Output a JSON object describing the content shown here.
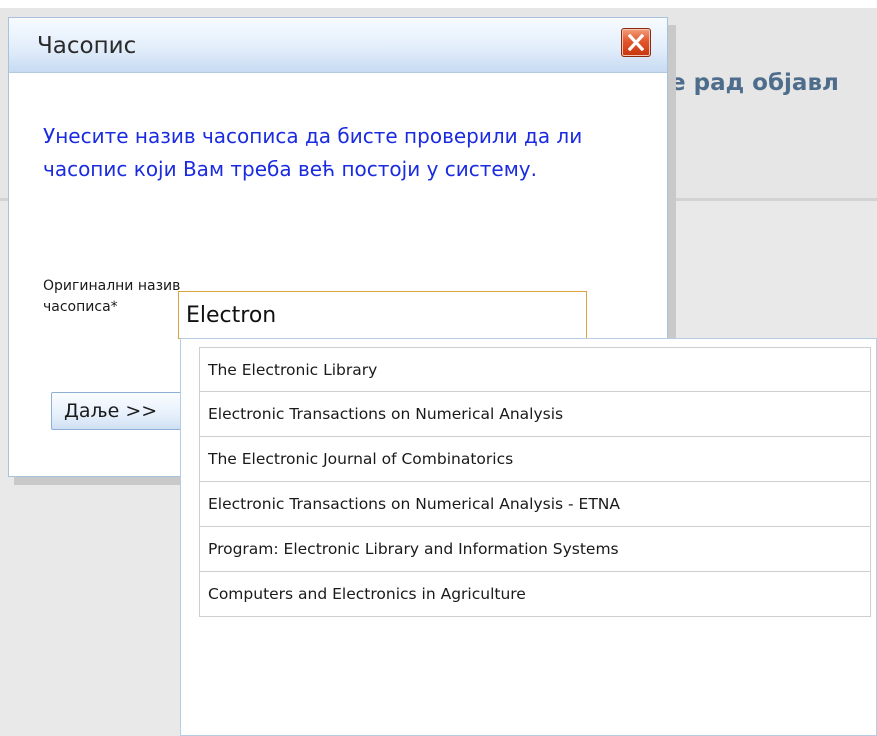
{
  "background": {
    "heading_fragment": "е рад објавл"
  },
  "dialog": {
    "title": "Часопис",
    "close_icon": "close-icon",
    "intro_text": "Унесите назив часописа да бисте проверили да ли часопис који Вам треба већ постоји у систему.",
    "field": {
      "label": "Оригинални назив часописа*",
      "value": "Electron",
      "placeholder": ""
    },
    "next_button_label": "Даље >>"
  },
  "autocomplete": {
    "items": [
      "The Electronic Library",
      "Electronic Transactions on Numerical Analysis",
      "The Electronic Journal of Combinatorics",
      "Electronic Transactions on Numerical Analysis - ETNA",
      "Program: Electronic Library and Information Systems",
      "Computers and Electronics in Agriculture"
    ]
  },
  "colors": {
    "intro_text": "#1a2be0",
    "heading": "#4e6d8c",
    "close_button": "#e2562c",
    "input_border": "#d9a33e"
  }
}
